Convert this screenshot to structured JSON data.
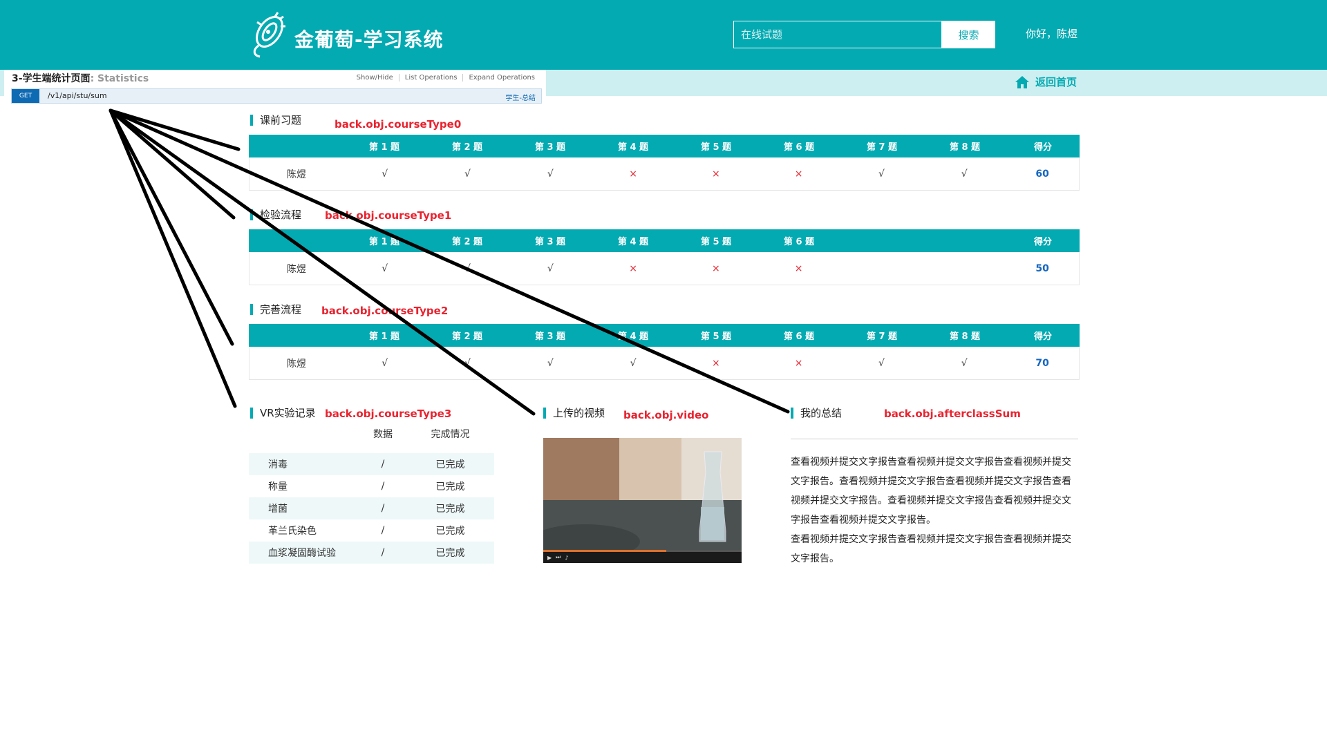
{
  "header": {
    "brand": "金葡萄-学习系统",
    "search_placeholder": "在线试题",
    "search_button": "搜索",
    "greeting": "你好，陈煜"
  },
  "subbar": {
    "home_link": "返回首页",
    "home_icon": "home-icon"
  },
  "swagger": {
    "title": "3-学生端统计页面",
    "title_suffix": ": Statistics",
    "ops": [
      "Show/Hide",
      "List Operations",
      "Expand Operations"
    ],
    "method": "GET",
    "path": "/v1/api/stu/sum",
    "tag": "学生-总结"
  },
  "sections": {
    "pre": {
      "title": "课前习题",
      "annotation": "back.obj.courseType0",
      "headers": [
        "第 1 题",
        "第 2 题",
        "第 3 题",
        "第 4 题",
        "第 5 题",
        "第 6 题",
        "第 7 题",
        "第 8 题"
      ],
      "score_header": "得分",
      "name": "陈煜",
      "marks": [
        "√",
        "√",
        "√",
        "×",
        "×",
        "×",
        "√",
        "√"
      ],
      "score": "60"
    },
    "inspect": {
      "title": "检验流程",
      "annotation": "back.obj.courseType1",
      "headers": [
        "第 1 题",
        "第 2 题",
        "第 3 题",
        "第 4 题",
        "第 5 题",
        "第 6 题"
      ],
      "score_header": "得分",
      "name": "陈煜",
      "marks": [
        "√",
        "√",
        "√",
        "×",
        "×",
        "×"
      ],
      "score": "50"
    },
    "refine": {
      "title": "完善流程",
      "annotation": "back.obj.courseType2",
      "headers": [
        "第 1 题",
        "第 2 题",
        "第 3 题",
        "第 4 题",
        "第 5 题",
        "第 6 题",
        "第 7 题",
        "第 8 题"
      ],
      "score_header": "得分",
      "name": "陈煜",
      "marks": [
        "√",
        "√",
        "√",
        "√",
        "×",
        "×",
        "√",
        "√"
      ],
      "score": "70"
    },
    "vr": {
      "title": "VR实验记录",
      "annotation": "back.obj.courseType3",
      "col_data": "数据",
      "col_status": "完成情况",
      "rows": [
        {
          "name": "消毒",
          "data": "/",
          "status": "已完成"
        },
        {
          "name": "称量",
          "data": "/",
          "status": "已完成"
        },
        {
          "name": "增菌",
          "data": "/",
          "status": "已完成"
        },
        {
          "name": "革兰氏染色",
          "data": "/",
          "status": "已完成"
        },
        {
          "name": "血浆凝固酶试验",
          "data": "/",
          "status": "已完成"
        }
      ]
    },
    "video": {
      "title": "上传的视频",
      "annotation": "back.obj.video",
      "progress": 0.62
    },
    "summary": {
      "title": "我的总结",
      "annotation": "back.obj.afterclassSum",
      "paragraphs": [
        "查看视频并提交文字报告查看视频并提交文字报告查看视频并提交文字报告。查看视频并提交文字报告查看视频并提交文字报告查看视频并提交文字报告。查看视频并提交文字报告查看视频并提交文字报告查看视频并提交文字报告。",
        "查看视频并提交文字报告查看视频并提交文字报告查看视频并提交文字报告。"
      ]
    }
  },
  "colors": {
    "teal": "#03aab2",
    "light_teal": "#cdeff1",
    "red": "#e8232f",
    "score_blue": "#1566c0"
  }
}
